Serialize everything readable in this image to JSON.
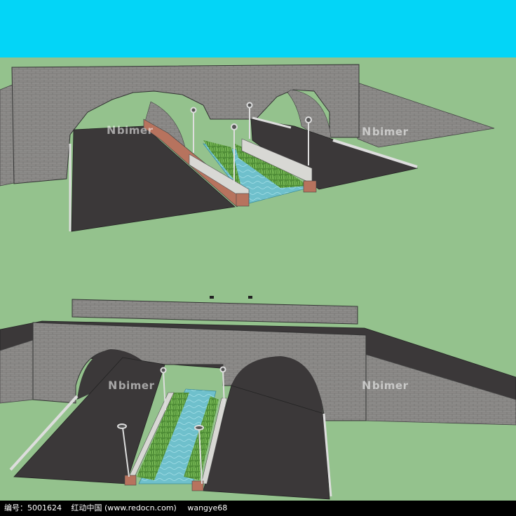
{
  "watermark": {
    "mark": "N",
    "text": "bimer"
  },
  "footer": {
    "id_text": "编号：5001624",
    "site_text": "红动中国 (www.redocn.com)",
    "author_text": "wangye68"
  },
  "colors": {
    "sky": "#03d5f7",
    "ground": "#94c28d",
    "brick": "#8d8c8a",
    "road": "#3b3839",
    "water": "#6fc0cc",
    "planter": "#b7735e",
    "plants": "#5a9a3e"
  }
}
